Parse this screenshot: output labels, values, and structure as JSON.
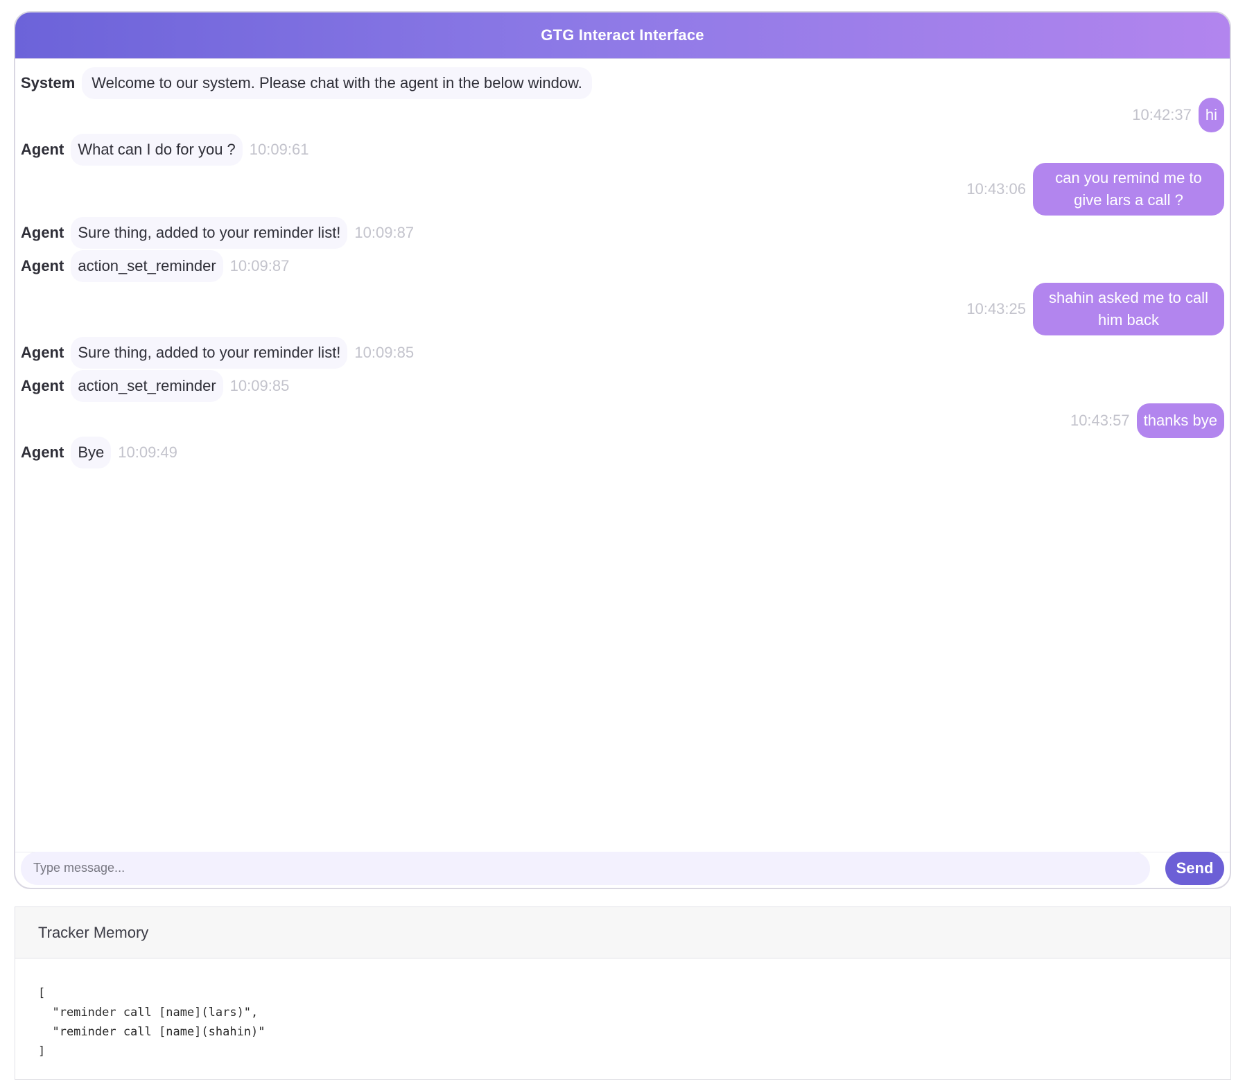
{
  "header": {
    "title": "GTG Interact Interface"
  },
  "messages": [
    {
      "side": "left",
      "type": "system",
      "sender": "System",
      "text": "Welcome to our system. Please chat with the agent in the below window.",
      "time": ""
    },
    {
      "side": "right",
      "text": "hi",
      "time": "10:42:37"
    },
    {
      "side": "left",
      "sender": "Agent",
      "text": "What can I do for you ?",
      "time": "10:09:61"
    },
    {
      "side": "right",
      "text": "can you remind me to give lars a call ?",
      "time": "10:43:06"
    },
    {
      "side": "left",
      "sender": "Agent",
      "text": "Sure thing, added to your reminder list!",
      "time": "10:09:87"
    },
    {
      "side": "left",
      "sender": "Agent",
      "text": "action_set_reminder",
      "time": "10:09:87"
    },
    {
      "side": "right",
      "text": "shahin asked me to call him back",
      "time": "10:43:25"
    },
    {
      "side": "left",
      "sender": "Agent",
      "text": "Sure thing, added to your reminder list!",
      "time": "10:09:85"
    },
    {
      "side": "left",
      "sender": "Agent",
      "text": "action_set_reminder",
      "time": "10:09:85"
    },
    {
      "side": "right",
      "text": "thanks bye",
      "time": "10:43:57"
    },
    {
      "side": "left",
      "sender": "Agent",
      "text": "Bye",
      "time": "10:09:49"
    }
  ],
  "input": {
    "placeholder": "Type message...",
    "value": ""
  },
  "send_button": {
    "label": "Send"
  },
  "tracker": {
    "title": "Tracker Memory",
    "entries": [
      "reminder call [name](lars)",
      "reminder call [name](shahin)"
    ]
  },
  "colors": {
    "header_start": "#6c63d9",
    "header_end": "#b285ee",
    "user_bubble": "#b285ee",
    "agent_bubble": "#f7f6fd",
    "send_button": "#6c5fd6",
    "input_bg": "#f3f1fe",
    "timestamp": "#c3c3cc"
  }
}
